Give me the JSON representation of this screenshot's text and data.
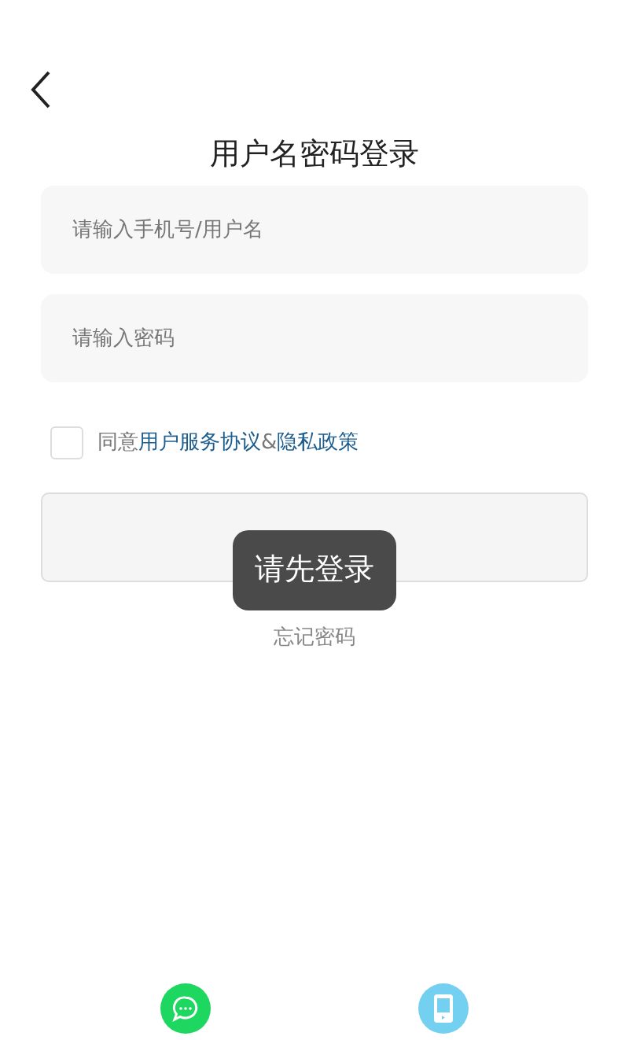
{
  "title": "用户名密码登录",
  "fields": [
    {
      "placeholder": "请输入手机号/用户名"
    },
    {
      "placeholder": "请输入密码"
    }
  ],
  "agreement": {
    "checked": false,
    "prefix": "同意",
    "links": [
      "用户服务协议",
      "隐私政策"
    ],
    "separator": "&"
  },
  "login_button": {
    "disabled": true
  },
  "toast": "请先登录",
  "forgot_password": "忘记密码",
  "bottom_icons": [
    {
      "kind": "chat"
    },
    {
      "kind": "phone"
    }
  ]
}
